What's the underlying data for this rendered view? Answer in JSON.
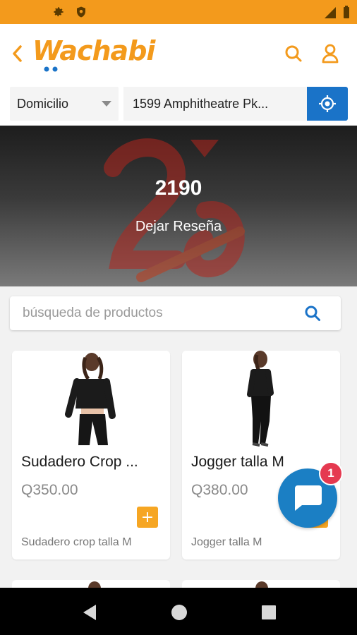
{
  "colors": {
    "accent": "#f39a1c",
    "primary_blue": "#1a73c8",
    "add_button": "#f6a623",
    "badge": "#e53950"
  },
  "header": {
    "logo_text": "Wachabi",
    "back_icon": "chevron-left-icon",
    "search_icon": "search-icon",
    "user_icon": "user-icon"
  },
  "location": {
    "delivery_type": "Domicilio",
    "address": "1599 Amphitheatre Pk...",
    "locate_icon": "crosshair-icon"
  },
  "store": {
    "name": "2190",
    "review_label": "Dejar Reseña"
  },
  "search": {
    "placeholder": "búsqueda de productos"
  },
  "products": [
    {
      "name": "Sudadero Crop ...",
      "price": "Q350.00",
      "description": "Sudadero crop talla M",
      "add_label": "+"
    },
    {
      "name": "Jogger talla M",
      "price": "Q380.00",
      "description": "Jogger talla M",
      "add_label": "+"
    }
  ],
  "chat": {
    "badge_count": "1"
  }
}
